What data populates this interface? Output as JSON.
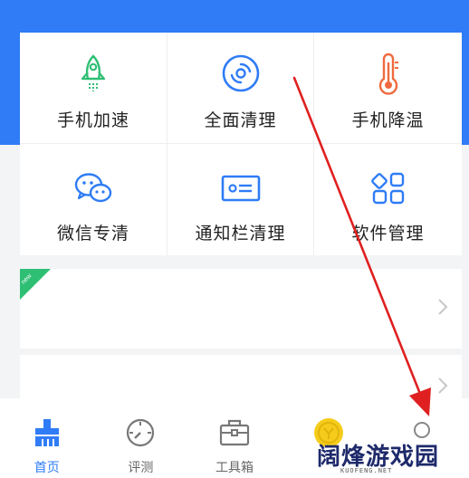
{
  "tools": [
    {
      "label": "手机加速",
      "icon": "rocket-icon",
      "color": "#2fbf74"
    },
    {
      "label": "全面清理",
      "icon": "disc-clean-icon",
      "color": "#2f7cf6"
    },
    {
      "label": "手机降温",
      "icon": "thermometer-icon",
      "color": "#f06a3f"
    },
    {
      "label": "微信专清",
      "icon": "wechat-icon",
      "color": "#2f7cf6"
    },
    {
      "label": "通知栏清理",
      "icon": "notification-card-icon",
      "color": "#2f7cf6"
    },
    {
      "label": "软件管理",
      "icon": "apps-grid-icon",
      "color": "#2f7cf6"
    }
  ],
  "feature_card": {
    "badge": "new"
  },
  "tabs": [
    {
      "label": "首页",
      "icon": "broom-icon",
      "active": true
    },
    {
      "label": "评测",
      "icon": "speedometer-icon",
      "active": false
    },
    {
      "label": "工具箱",
      "icon": "toolbox-icon",
      "active": false
    },
    {
      "label": "",
      "icon": "coin-icon",
      "active": false
    },
    {
      "label": "",
      "icon": "profile-icon",
      "active": false
    }
  ],
  "watermark": {
    "title": "阔烽游戏园",
    "url": "KUOFENG.NET"
  },
  "colors": {
    "brand_blue": "#2f7cf6",
    "arrow_red": "#e02020",
    "coin_yellow": "#f5cc1b"
  }
}
